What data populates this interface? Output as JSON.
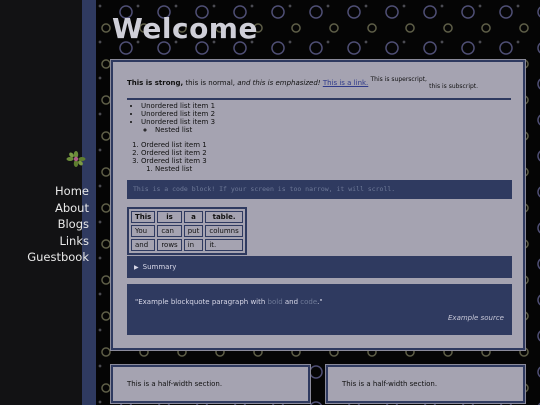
{
  "site": {
    "title": "Welcome"
  },
  "nav": [
    {
      "label": "Home"
    },
    {
      "label": "About"
    },
    {
      "label": "Blogs"
    },
    {
      "label": "Links"
    },
    {
      "label": "Guestbook"
    }
  ],
  "content": {
    "strong": "This is strong,",
    "normal": "this is normal,",
    "emphasized": "and this is emphasized!",
    "link": "This is a link.",
    "superscript": "This is superscript,",
    "subscript": "this is subscript."
  },
  "unordered_list": {
    "items": [
      "Unordered list item 1",
      "Unordered list item 2",
      "Unordered list item 3"
    ],
    "nested": [
      "Nested list"
    ]
  },
  "ordered_list": {
    "items": [
      "Ordered list item 1",
      "Ordered list item 2",
      "Ordered list item 3"
    ],
    "nested": [
      "Nested list"
    ]
  },
  "code_block": "This is a code block! If your screen is too narrow, it will scroll.",
  "table": {
    "headers": [
      "This",
      "is",
      "a",
      "table."
    ],
    "rows": [
      [
        "You",
        "can",
        "put",
        "columns"
      ],
      [
        "and",
        "rows",
        "in",
        "it."
      ]
    ]
  },
  "details": {
    "summary": "Summary"
  },
  "blockquote": {
    "before": "\"Example blockquote paragraph with ",
    "highlight1": "bold",
    "middle": " and ",
    "highlight2": "code",
    "after": ".\"",
    "source": "Example source"
  },
  "half_sections": [
    {
      "text": "This is a half-width section."
    },
    {
      "text": "This is a half-width section."
    }
  ],
  "colors": {
    "background": "#050505",
    "sidebar": "#121214",
    "accent_navy": "#2f3a60",
    "panel": "#a5a3b1",
    "title": "#cfcfd8"
  }
}
